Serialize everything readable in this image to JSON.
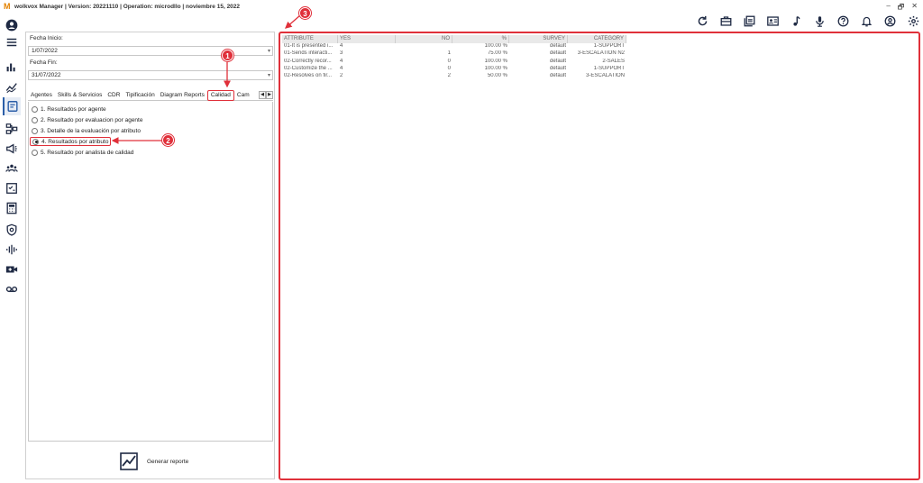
{
  "window": {
    "logo": "M",
    "title": "wolkvox Manager  | Version: 20221110 |  Operation: microdllo | noviembre 15, 2022",
    "minimize": "–",
    "restore": "🗗",
    "close": "✕"
  },
  "toolbar": {
    "icons": [
      "refresh-icon",
      "briefcase-icon",
      "gallery-icon",
      "contact-card-icon",
      "music-note-icon",
      "microphone-icon",
      "help-icon",
      "bell-icon",
      "user-icon",
      "gear-icon"
    ]
  },
  "sidebar": {
    "items": [
      "user-avatar-icon",
      "menu-icon",
      "bar-chart-icon",
      "graph-icon",
      "report-icon",
      "workflow-icon",
      "campaign-icon",
      "group-icon",
      "checklist-icon",
      "calculator-icon",
      "shield-icon",
      "audio-wave-icon",
      "video-plus-icon",
      "voicemail-icon"
    ]
  },
  "filters": {
    "start_label": "Fecha Inicio:",
    "start_value": "1/07/2022",
    "end_label": "Fecha Fin:",
    "end_value": "31/07/2022"
  },
  "tabs": [
    "Agentes",
    "Skills & Servicios",
    "CDR",
    "Tipificación",
    "Diagram Reports",
    "Calidad",
    "Cam"
  ],
  "selected_tab": "Calidad",
  "options": [
    "1. Resultados por agente",
    "2. Resultado por evaluacion por agente",
    "3. Detalle de la evaluación por atributo",
    "4. Resultados por atributo",
    "5. Resultado por analista de calidad"
  ],
  "selected_option": "4. Resultados por atributo",
  "generate_label": "Generar reporte",
  "callouts": [
    "1",
    "2",
    "3"
  ],
  "table": {
    "columns": [
      "ATTRIBUTE",
      "YES",
      "NO",
      "%",
      "SURVEY",
      "CATEGORY"
    ],
    "rows": [
      [
        "01-It is presented i...",
        "4",
        "",
        "100.00 %",
        "default",
        "1-SUPPORT"
      ],
      [
        "01-Sends interacti...",
        "3",
        "1",
        "75.00 %",
        "default",
        "3-ESCALATION N2"
      ],
      [
        "02-Correctly recor...",
        "4",
        "0",
        "100.00 %",
        "default",
        "2-SALES"
      ],
      [
        "02-Customize the ...",
        "4",
        "0",
        "100.00 %",
        "default",
        "1-SUPPORT"
      ],
      [
        "02-Resolves on fir...",
        "2",
        "2",
        "50.00 %",
        "default",
        "3-ESCALATION"
      ]
    ]
  },
  "colors": {
    "accent": "#e0303a",
    "logo": "#e38200",
    "icon": "#1f2a44"
  }
}
